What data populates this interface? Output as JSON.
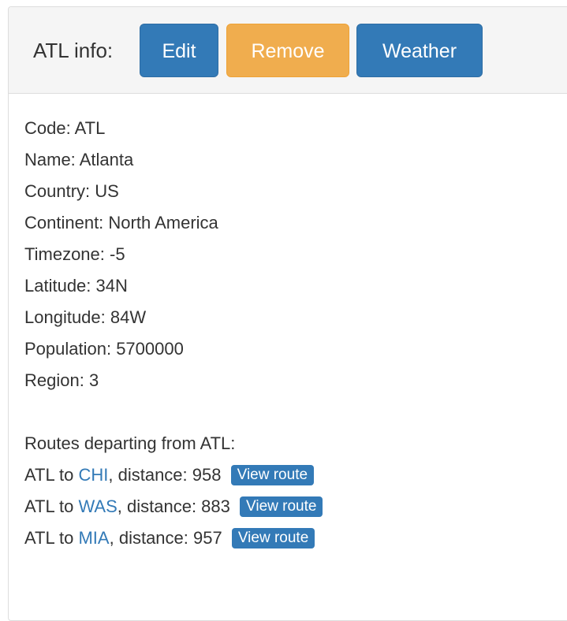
{
  "header": {
    "title": "ATL info:",
    "edit_label": "Edit",
    "remove_label": "Remove",
    "weather_label": "Weather"
  },
  "info": [
    {
      "text": "Code: ATL"
    },
    {
      "text": "Name: Atlanta"
    },
    {
      "text": "Country: US"
    },
    {
      "text": "Continent: North America"
    },
    {
      "text": "Timezone: -5"
    },
    {
      "text": "Latitude: 34N"
    },
    {
      "text": "Longitude: 84W"
    },
    {
      "text": "Population: 5700000"
    },
    {
      "text": "Region: 3"
    }
  ],
  "routes": {
    "heading": "Routes departing from ATL:",
    "items": [
      {
        "prefix": "ATL to ",
        "dest": "CHI",
        "suffix": ", distance: 958",
        "button": "View route"
      },
      {
        "prefix": "ATL to ",
        "dest": "WAS",
        "suffix": ", distance: 883",
        "button": "View route"
      },
      {
        "prefix": "ATL to ",
        "dest": "MIA",
        "suffix": ", distance: 957",
        "button": "View route"
      }
    ]
  },
  "colors": {
    "primary": "#337ab7",
    "warning": "#f0ad4e",
    "heading_bg": "#f5f5f5",
    "text": "#333333"
  }
}
